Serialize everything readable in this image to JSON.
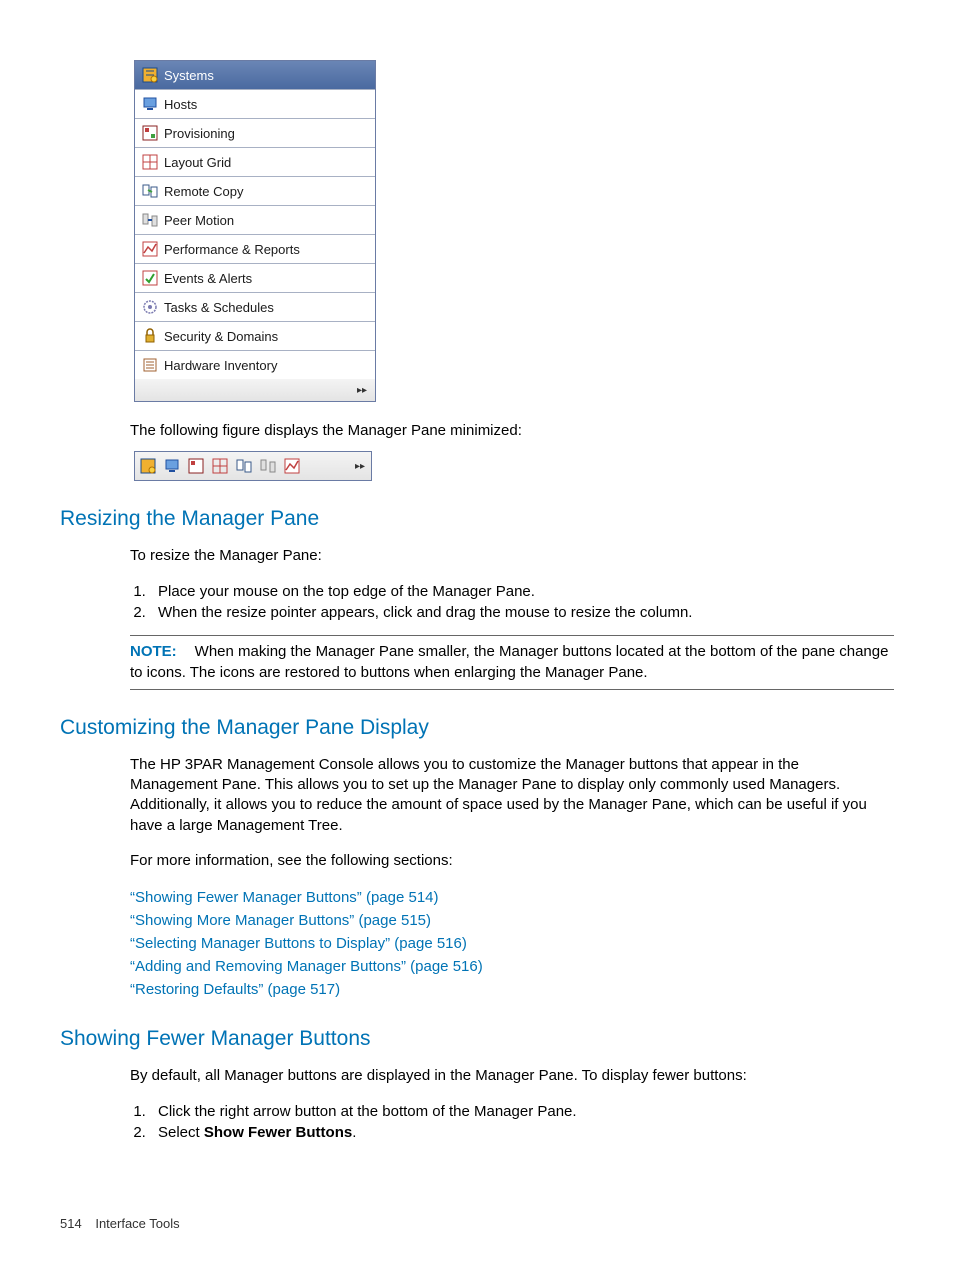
{
  "manager_pane": {
    "items": [
      {
        "label": "Systems",
        "icon": "systems-icon",
        "selected": true
      },
      {
        "label": "Hosts",
        "icon": "hosts-icon",
        "selected": false
      },
      {
        "label": "Provisioning",
        "icon": "provisioning-icon",
        "selected": false
      },
      {
        "label": "Layout Grid",
        "icon": "layout-grid-icon",
        "selected": false
      },
      {
        "label": "Remote Copy",
        "icon": "remote-copy-icon",
        "selected": false
      },
      {
        "label": "Peer Motion",
        "icon": "peer-motion-icon",
        "selected": false
      },
      {
        "label": "Performance & Reports",
        "icon": "performance-icon",
        "selected": false
      },
      {
        "label": "Events & Alerts",
        "icon": "events-icon",
        "selected": false
      },
      {
        "label": "Tasks & Schedules",
        "icon": "tasks-icon",
        "selected": false
      },
      {
        "label": "Security & Domains",
        "icon": "security-icon",
        "selected": false
      },
      {
        "label": "Hardware Inventory",
        "icon": "hardware-icon",
        "selected": false
      }
    ]
  },
  "caption1": "The following figure displays the Manager Pane minimized:",
  "mini_pane": {
    "icons": [
      "systems-icon",
      "hosts-icon",
      "provisioning-icon",
      "layout-grid-icon",
      "remote-copy-icon",
      "peer-motion-icon",
      "performance-icon"
    ]
  },
  "section_resize": {
    "heading": "Resizing the Manager Pane",
    "intro": "To resize the Manager Pane:",
    "steps": [
      "Place your mouse on the top edge of the Manager Pane.",
      "When the resize pointer appears, click and drag the mouse to resize the column."
    ],
    "note_label": "NOTE:",
    "note_text": "When making the Manager Pane smaller, the Manager buttons located at the bottom of the pane change to icons. The icons are restored to buttons when enlarging the Manager Pane."
  },
  "section_custom": {
    "heading": "Customizing the Manager Pane Display",
    "para": "The HP 3PAR Management Console allows you to customize the Manager buttons that appear in the Management Pane. This allows you to set up the Manager Pane to display only commonly used Managers. Additionally, it allows you to reduce the amount of space used by the Manager Pane, which can be useful if you have a large Management Tree.",
    "para2": "For more information, see the following sections:",
    "links": [
      "“Showing Fewer Manager Buttons” (page 514)",
      "“Showing More Manager Buttons” (page 515)",
      "“Selecting Manager Buttons to Display” (page 516)",
      "“Adding and Removing Manager Buttons” (page 516)",
      "“Restoring Defaults” (page 517)"
    ]
  },
  "section_fewer": {
    "heading": "Showing Fewer Manager Buttons",
    "para": "By default, all Manager buttons are displayed in the Manager Pane. To display fewer buttons:",
    "steps": [
      "Click the right arrow button at the bottom of the Manager Pane.",
      "Select "
    ],
    "step2_bold": "Show Fewer Buttons",
    "step2_tail": "."
  },
  "footer": {
    "page": "514",
    "section": "Interface Tools"
  }
}
